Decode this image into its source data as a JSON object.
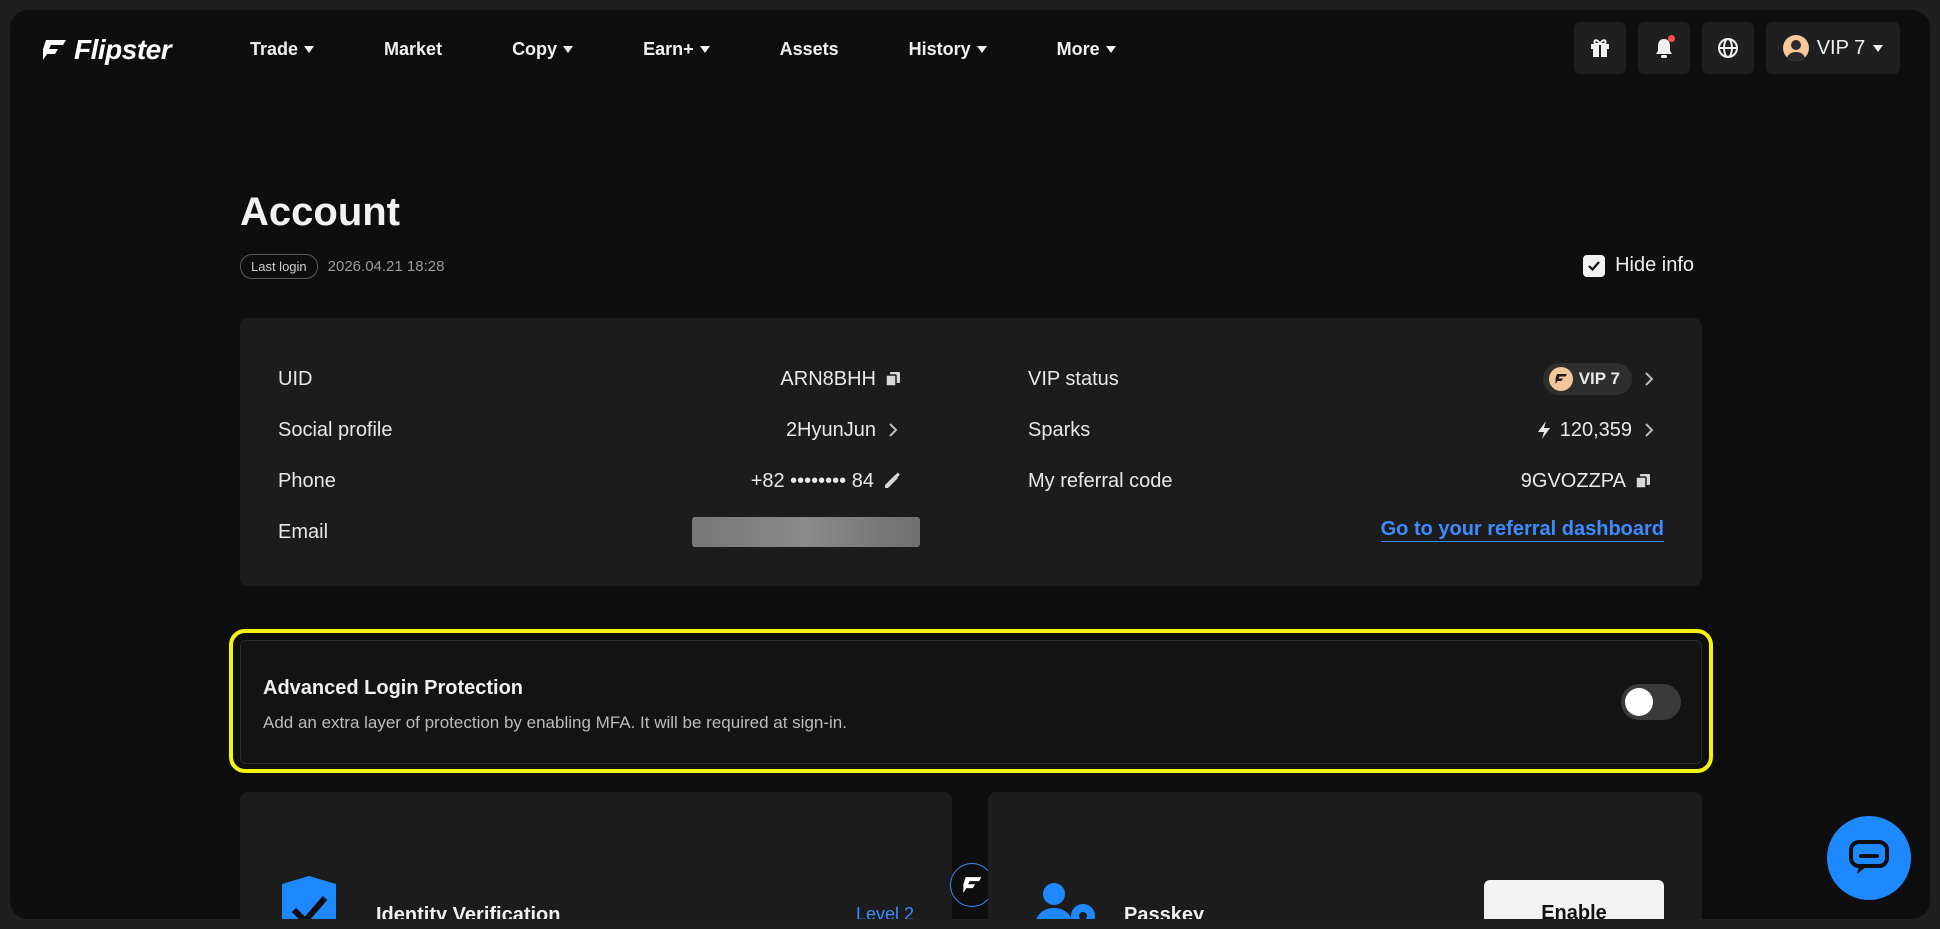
{
  "nav": {
    "logo": "Flipster",
    "items": [
      {
        "label": "Trade",
        "dropdown": true
      },
      {
        "label": "Market",
        "dropdown": false
      },
      {
        "label": "Copy",
        "dropdown": true
      },
      {
        "label": "Earn+",
        "dropdown": true
      },
      {
        "label": "Assets",
        "dropdown": false
      },
      {
        "label": "History",
        "dropdown": true
      },
      {
        "label": "More",
        "dropdown": true
      }
    ],
    "vip_label": "VIP 7",
    "icons": [
      "gift-icon",
      "bell-icon",
      "globe-icon",
      "avatar-icon"
    ]
  },
  "account": {
    "title": "Account",
    "last_login_badge": "Last login",
    "last_login_time": "2026.04.21 18:28",
    "hide_info_label": "Hide info",
    "hide_info_checked": true
  },
  "info": {
    "uid_label": "UID",
    "uid_value": "ARN8BHH",
    "social_label": "Social profile",
    "social_value": "2HyunJun",
    "phone_label": "Phone",
    "phone_value": "+82 •••••••• 84",
    "email_label": "Email",
    "vip_label": "VIP status",
    "vip_value": "VIP 7",
    "sparks_label": "Sparks",
    "sparks_value": "120,359",
    "referral_label": "My referral code",
    "referral_value": "9GVOZZPA",
    "referral_link": "Go to your referral dashboard"
  },
  "alp": {
    "title": "Advanced Login Protection",
    "description": "Add an extra layer of protection by enabling MFA. It will be required at sign-in.",
    "enabled": false
  },
  "cards": {
    "identity_title": "Identity Verification",
    "identity_level": "Level 2",
    "passkey_title": "Passkey",
    "passkey_button": "Enable"
  },
  "colors": {
    "accent": "#3c8cff",
    "highlight": "#f4f40a",
    "background": "#0e0e0e"
  }
}
